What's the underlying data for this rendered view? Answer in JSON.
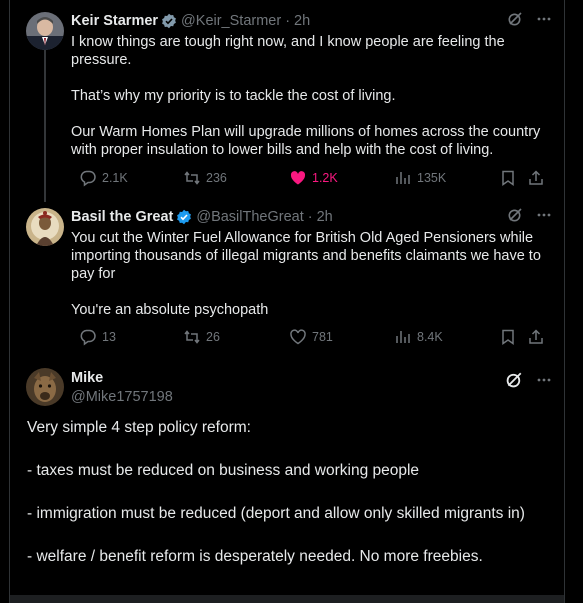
{
  "tweets": [
    {
      "name": "Keir Starmer",
      "handle": "@Keir_Starmer",
      "sep": "·",
      "time": "2h",
      "paragraphs": [
        "I know things are tough right now, and I know people are feeling the pressure.",
        "That’s why my priority is to tackle the cost of living.",
        "Our Warm Homes Plan will upgrade millions of homes across the country with proper insulation to lower bills and help with the cost of living."
      ],
      "stats": {
        "replies": "2.1K",
        "reposts": "236",
        "likes": "1.2K",
        "views": "135K"
      },
      "liked": true
    },
    {
      "name": "Basil the Great",
      "handle": "@BasilTheGreat",
      "sep": "·",
      "time": "2h",
      "paragraphs": [
        "You cut the Winter Fuel Allowance for British Old Aged Pensioners while importing thousands of illegal migrants and benefits claimants we have to pay for",
        "You're an absolute psychopath"
      ],
      "stats": {
        "replies": "13",
        "reposts": "26",
        "likes": "781",
        "views": "8.4K"
      },
      "liked": false
    },
    {
      "name": "Mike",
      "handle": "@Mike1757198",
      "paragraphs": [
        "Very simple 4 step policy reform:",
        "- taxes must be reduced on business and working people",
        "- immigration must be reduced (deport and allow only skilled migrants in)",
        "- welfare / benefit reform is desperately needed. No more freebies."
      ]
    }
  ],
  "colors": {
    "verified": "#1d9bf0",
    "like": "#f91880",
    "muted": "#71767b",
    "text": "#e7e9ea"
  },
  "icons": [
    "grok-icon",
    "more-icon",
    "reply-icon",
    "repost-icon",
    "like-icon",
    "views-icon",
    "bookmark-icon",
    "share-icon",
    "verified-badge-icon"
  ]
}
